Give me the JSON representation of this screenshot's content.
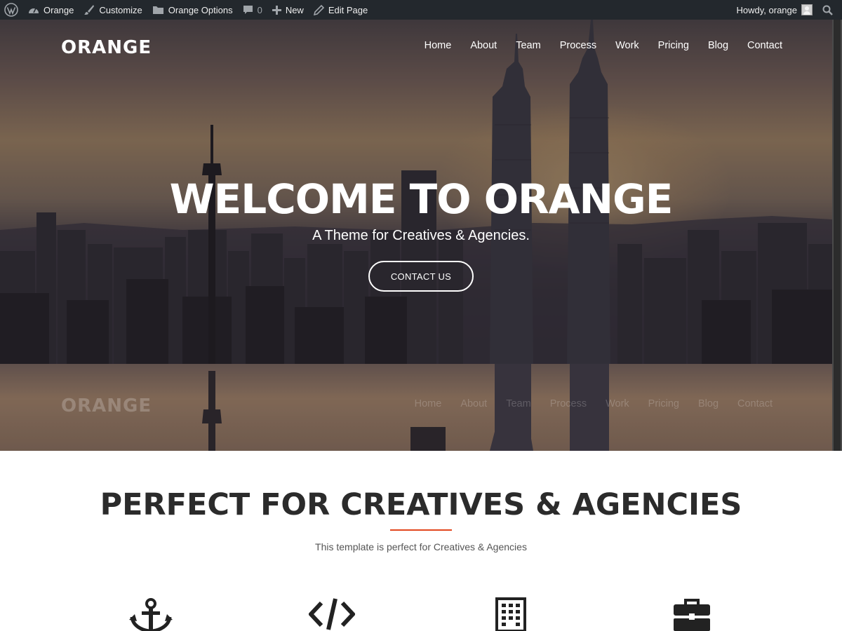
{
  "adminbar": {
    "items": [
      {
        "label": "Orange",
        "icon": "dashboard-icon"
      },
      {
        "label": "Customize",
        "icon": "brush-icon"
      },
      {
        "label": "Orange Options",
        "icon": "folder-icon"
      },
      {
        "label": "0",
        "icon": "comment-icon"
      },
      {
        "label": "New",
        "icon": "plus-icon"
      },
      {
        "label": "Edit Page",
        "icon": "pencil-icon"
      }
    ],
    "greeting": "Howdy, orange"
  },
  "site": {
    "logo": "ORANGE",
    "nav": [
      "Home",
      "About",
      "Team",
      "Process",
      "Work",
      "Pricing",
      "Blog",
      "Contact"
    ]
  },
  "hero": {
    "title": "WELCOME TO ORANGE",
    "subtitle": "A Theme for Creatives & Agencies.",
    "button": "CONTACT US"
  },
  "features": {
    "title": "PERFECT FOR CREATIVES & AGENCIES",
    "subtitle": "This template is perfect for Creatives & Agencies",
    "icons": [
      "anchor-icon",
      "code-icon",
      "building-icon",
      "briefcase-icon"
    ]
  },
  "colors": {
    "accent": "#e2461d",
    "adminbar": "#23282d",
    "heading": "#2b2b2b"
  }
}
